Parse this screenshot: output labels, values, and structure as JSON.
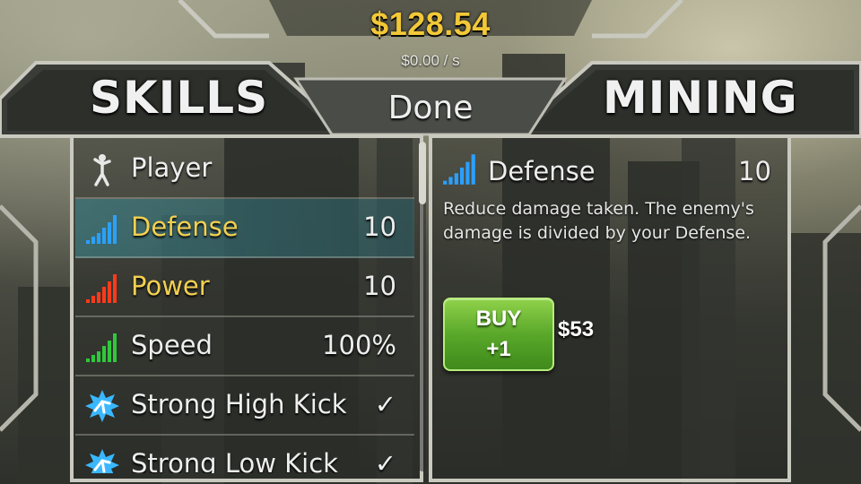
{
  "header": {
    "money": "$128.54",
    "rate": "$0.00 / s"
  },
  "tabs": {
    "skills": "SKILLS",
    "mining": "MINING",
    "done": "Done"
  },
  "skills_list": [
    {
      "label": "Player",
      "value": "",
      "icon": "player-figure-icon",
      "selected": false
    },
    {
      "label": "Defense",
      "value": "10",
      "icon": "defense-bars-icon",
      "selected": true
    },
    {
      "label": "Power",
      "value": "10",
      "icon": "power-bars-icon",
      "selected": false
    },
    {
      "label": "Speed",
      "value": "100%",
      "icon": "speed-bars-icon",
      "selected": false
    },
    {
      "label": "Strong High Kick",
      "value": "✓",
      "icon": "kick-burst-icon",
      "selected": false
    },
    {
      "label": "Strong Low Kick",
      "value": "✓",
      "icon": "kick-burst-icon",
      "selected": false
    }
  ],
  "detail": {
    "title": "Defense",
    "value": "10",
    "description": "Reduce damage taken. The enemy's damage is divided by your Defense.",
    "buy_line1": "BUY",
    "buy_line2": "+1",
    "price": "$53"
  },
  "colors": {
    "money": "#f2c838",
    "highlight_text": "#f2d050",
    "selected_row": "#3c8c96",
    "buy_button": "#5aa82a",
    "defense_bars": "#2aa0ff",
    "power_bars": "#ff3a1a",
    "speed_bars": "#2ec83a"
  }
}
